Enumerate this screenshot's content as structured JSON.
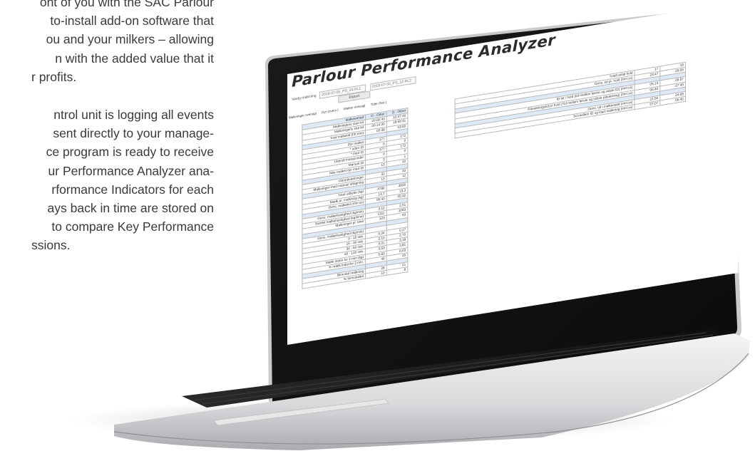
{
  "brochure": {
    "paragraph1": [
      "ont of you with the SAC Parlour",
      "to-install add-on software that",
      "ou and your milkers – allowing",
      "n with the added value that it",
      "r profits."
    ],
    "paragraph2": [
      "ntrol unit is logging all events",
      "sent directly to your manage-",
      "ce program is ready to receive",
      "ur Performance Analyzer ana-",
      "rformance Indicators for each",
      "ays back in time are stored on",
      "to compare Key Performance",
      "ssions."
    ]
  },
  "app": {
    "title": "Parlour Performance Analyzer",
    "filter_label": "Vaelg malkning",
    "select1": "2019-07-05_PS_24.RL1",
    "select2": "2019-07-05_PS_12.RL2",
    "export_label": "Export",
    "tabs": [
      "Malkninger oversigt",
      "Dyr (overs.)",
      "Malker oversigt",
      "Tider (hist.)"
    ],
    "left_table": [
      {
        "label": "Malkeenhed",
        "v1": "O - Other",
        "v2": "O - Other",
        "type": "h"
      },
      {
        "label": "Malkningens start tid",
        "v1": "20:00:49",
        "v2": "12:37:46"
      },
      {
        "label": "Malkningens slut tid",
        "v1": "00:14:30",
        "v2": "18:59:31"
      },
      {
        "label": "Total malketid (hh:mm)",
        "v1": "03:38",
        "v2": "03:00"
      },
      {
        "label": "",
        "v1": "",
        "v2": "",
        "type": "sp"
      },
      {
        "label": "Dyr malket",
        "v1": "177",
        "v2": "172"
      },
      {
        "label": "* uden ID",
        "v1": "0",
        "v2": "0"
      },
      {
        "label": "* med ID",
        "v1": "177",
        "v2": "172"
      },
      {
        "label": "Ukendt transponder",
        "v1": "0",
        "v2": "0"
      },
      {
        "label": "Manuel ID",
        "v1": "3",
        "v2": "1"
      },
      {
        "label": "Ikke malket dyr med ID",
        "v1": "13",
        "v2": "10"
      },
      {
        "label": "",
        "v1": "",
        "v2": "",
        "type": "sp"
      },
      {
        "label": "Genpåsætninger",
        "v1": "32",
        "v2": "33"
      },
      {
        "label": "Malkninger med manuel aftagning",
        "v1": "13",
        "v2": "12"
      },
      {
        "label": "",
        "v1": "",
        "v2": "",
        "type": "sp"
      },
      {
        "label": "Total udbytte (kg)",
        "v1": "4780",
        "v2": "3025"
      },
      {
        "label": "Mælk pr. malkning (kg)",
        "v1": "14,7",
        "v2": "13,3"
      },
      {
        "label": "Gens. malketid (mm:ss)",
        "v1": "05:40",
        "v2": "05:32"
      },
      {
        "label": "",
        "v1": "",
        "v2": "",
        "type": "sp"
      },
      {
        "label": "Gens. malkehastighed (kg/min)",
        "v1": "3,12",
        "v2": "2,91"
      },
      {
        "label": "Samlet malkehastighed (kg/time)",
        "v1": "1311",
        "v2": "1083"
      },
      {
        "label": "Malkninger pr. time",
        "v1": "103",
        "v2": "93"
      },
      {
        "label": "",
        "v1": "",
        "v2": "",
        "type": "sp"
      },
      {
        "label": "Gens. malkehastighed (kg/min)",
        "v1": "",
        "v2": ""
      },
      {
        "label": "0 - 15 sek.",
        "v1": "0,04",
        "v2": "0,17"
      },
      {
        "label": "15 - 30 sek.",
        "v1": "2,19",
        "v2": "2,70"
      },
      {
        "label": "30 - 60 sek.",
        "v1": "3,01",
        "v2": "3,18"
      },
      {
        "label": "60 - 120 sek.",
        "v1": "3,53",
        "v2": "3,81"
      },
      {
        "label": "Mælk inden for 2 min (kg)",
        "v1": "5,83",
        "v2": "6,03"
      },
      {
        "label": "% mælk indenfor 2 min.",
        "v1": "46",
        "v2": "45"
      },
      {
        "label": "",
        "v1": "",
        "v2": "",
        "type": "sp"
      },
      {
        "label": "Bimodal malkning",
        "v1": "28",
        "v2": "21"
      },
      {
        "label": "% bimodalitet",
        "v1": "10",
        "v2": "8"
      }
    ],
    "right_table": [
      {
        "label": "Totalt antal hold",
        "v1": "17",
        "v2": "18"
      },
      {
        "label": "Gens. tid pr. hold (mm:ss)",
        "v1": "23:47",
        "v2": "26:29"
      },
      {
        "label": "",
        "v1": "",
        "v2": "",
        "type": "sp"
      },
      {
        "label": "ID tid / hold (tid mellem første og sidste ID) (mm:ss)",
        "v1": "05:13",
        "v2": "06:57"
      },
      {
        "label": "Påsætningstid pr hold (Tid mellem første og sidste påsætning) (mm:ss)",
        "v1": "06:40",
        "v2": "07:45"
      },
      {
        "label": "",
        "v1": "",
        "v2": "",
        "type": "sp"
      },
      {
        "label": "Gens. tid i malkestald (mm:ss)",
        "v1": "21:50",
        "v2": "24:08"
      },
      {
        "label": "Tid mellem ID og start malkning (mm:ss)",
        "v1": "07:07",
        "v2": "06:40"
      }
    ]
  }
}
